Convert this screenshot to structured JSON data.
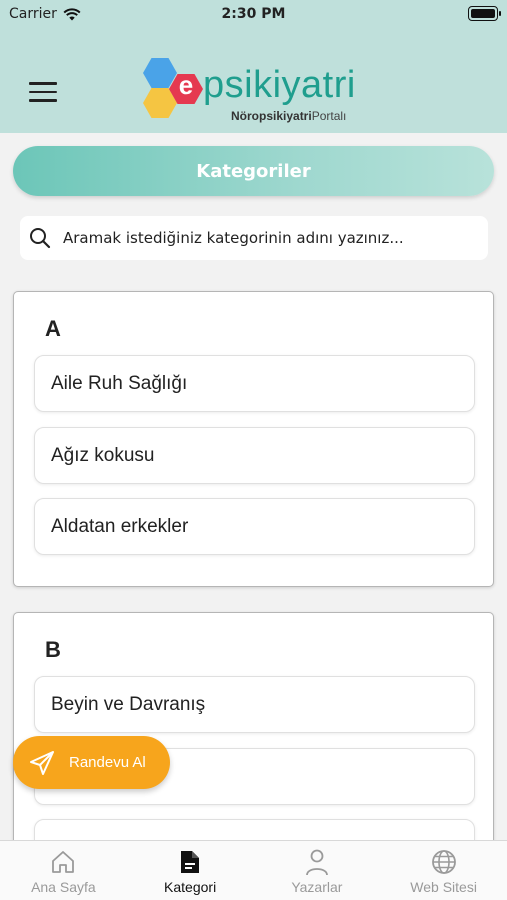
{
  "status_bar": {
    "carrier": "Carrier",
    "time": "2:30 PM"
  },
  "header": {
    "logo": {
      "brand_letter": "e",
      "brand_word": "psikiyatri",
      "tagline_bold": "Nöropsikiyatri",
      "tagline": "Portalı"
    }
  },
  "page": {
    "title": "Kategoriler"
  },
  "search": {
    "placeholder": "Aramak istediğiniz kategorinin adını yazınız..."
  },
  "sections": [
    {
      "letter": "A",
      "items": [
        "Aile Ruh Sağlığı",
        "Ağız kokusu",
        "Aldatan erkekler"
      ]
    },
    {
      "letter": "B",
      "items": [
        "Beyin ve Davranış"
      ]
    }
  ],
  "fab": {
    "label": "Randevu Al"
  },
  "tabs": [
    {
      "label": "Ana Sayfa",
      "icon": "home-icon",
      "active": false
    },
    {
      "label": "Kategori",
      "icon": "document-icon",
      "active": true
    },
    {
      "label": "Yazarlar",
      "icon": "user-icon",
      "active": false
    },
    {
      "label": "Web Sitesi",
      "icon": "globe-icon",
      "active": false
    }
  ],
  "colors": {
    "header_bg": "#bfe0db",
    "accent": "#6cc6b8",
    "fab": "#f7a51c",
    "logo_text": "#1f9e8e"
  }
}
